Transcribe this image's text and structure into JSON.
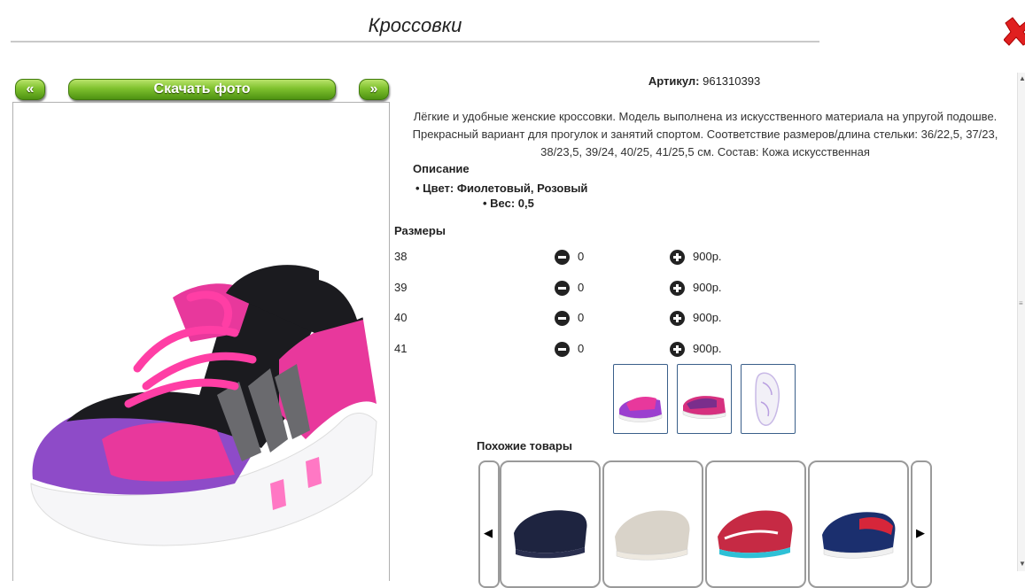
{
  "title": "Кроссовки",
  "nav": {
    "prev": "«",
    "download": "Скачать фото",
    "next": "»"
  },
  "product": {
    "article_label": "Артикул:",
    "article_value": "961310393",
    "description": "Лёгкие и удобные женские кроссовки. Модель выполнена из искусственного материала на упругой подошве. Прекрасный вариант для прогулок и занятий спортом. Соответствие размеров/длина стельки: 36/22,5, 37/23, 38/23,5, 39/24, 40/25, 41/25,5 см. Состав: Кожа искусственная",
    "description_heading": "Описание",
    "attributes": [
      "• Цвет: Фиолетовый, Розовый",
      "• Вес: 0,5"
    ],
    "sizes_heading": "Размеры",
    "sizes": [
      {
        "size": "38",
        "qty": "0",
        "price": "900р."
      },
      {
        "size": "39",
        "qty": "0",
        "price": "900р."
      },
      {
        "size": "40",
        "qty": "0",
        "price": "900р."
      },
      {
        "size": "41",
        "qty": "0",
        "price": "900р."
      }
    ]
  },
  "similar": {
    "heading": "Похожие товары",
    "prev_arrow": "◀",
    "next_arrow": "▶"
  },
  "icons": {
    "close": "close-icon",
    "minus": "minus-circle-icon",
    "plus": "plus-circle-icon"
  },
  "colors": {
    "accent_green": "#7fc12e",
    "close_red": "#e02020",
    "thumb_border": "#3a5f8a"
  }
}
